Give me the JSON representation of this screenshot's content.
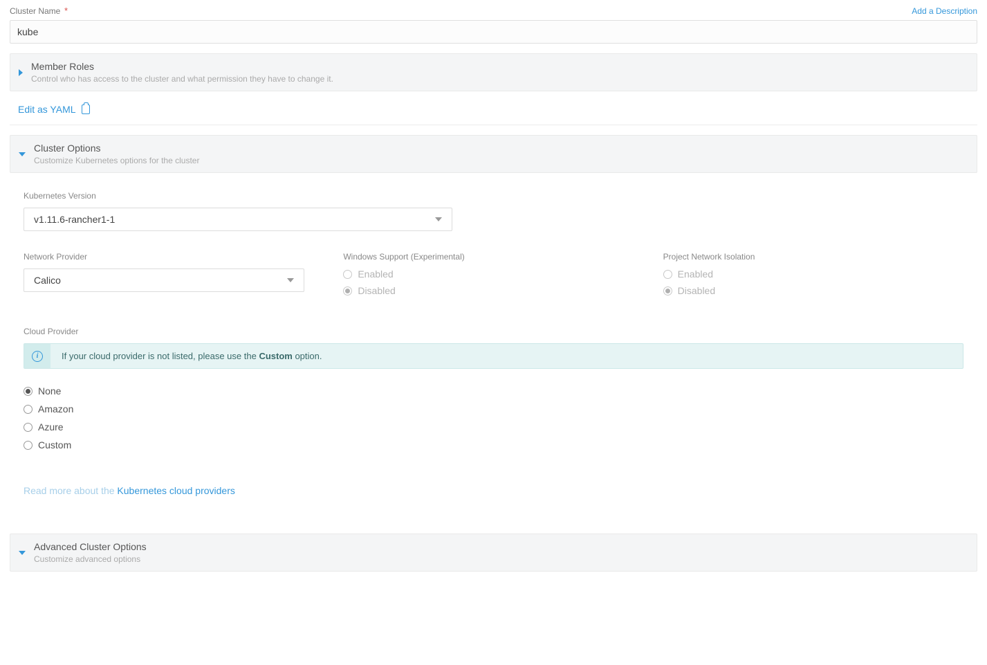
{
  "header": {
    "cluster_name_label": "Cluster Name",
    "add_description_link": "Add a Description",
    "cluster_name_value": "kube"
  },
  "member_roles": {
    "title": "Member Roles",
    "subtitle": "Control who has access to the cluster and what permission they have to change it."
  },
  "yaml": {
    "edit_label": "Edit as YAML"
  },
  "cluster_options": {
    "title": "Cluster Options",
    "subtitle": "Customize Kubernetes options for the cluster",
    "k8s_version_label": "Kubernetes Version",
    "k8s_version_value": "v1.11.6-rancher1-1",
    "network_provider_label": "Network Provider",
    "network_provider_value": "Calico",
    "windows_support_label": "Windows Support (Experimental)",
    "windows_enabled": "Enabled",
    "windows_disabled": "Disabled",
    "pni_label": "Project Network Isolation",
    "pni_enabled": "Enabled",
    "pni_disabled": "Disabled",
    "cloud_provider_label": "Cloud Provider",
    "cloud_info_prefix": "If your cloud provider is not listed, please use the ",
    "cloud_info_bold": "Custom",
    "cloud_info_suffix": " option.",
    "cloud_none": "None",
    "cloud_amazon": "Amazon",
    "cloud_azure": "Azure",
    "cloud_custom": "Custom",
    "readmore_dim": "Read more about the ",
    "readmore_link": "Kubernetes cloud providers"
  },
  "advanced": {
    "title": "Advanced Cluster Options",
    "subtitle": "Customize advanced options"
  }
}
